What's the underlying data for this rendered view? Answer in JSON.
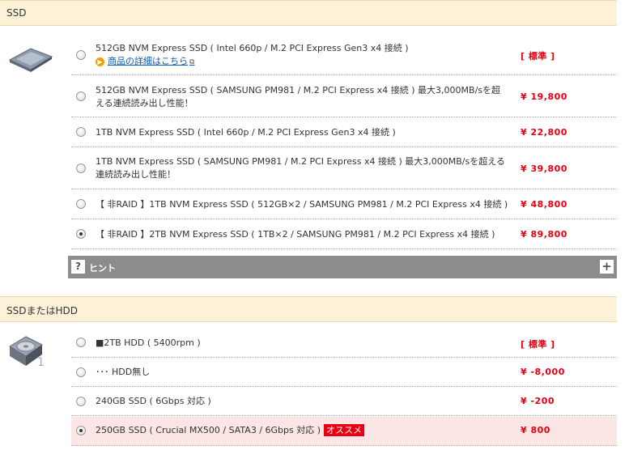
{
  "sections": [
    {
      "title": "SSD",
      "options": [
        {
          "label": "512GB NVM Express SSD ( Intel 660p / M.2 PCI Express Gen3 x4 接続 )",
          "price": "[ 標準 ]",
          "checked": false,
          "detail_link": "商品の詳細はこちら"
        },
        {
          "label": "512GB NVM Express SSD ( SAMSUNG PM981 / M.2 PCI Express x4 接続 ) 最大3,000MB/sを超える連続読み出し性能！",
          "price": "¥ 19,800",
          "checked": false
        },
        {
          "label": "1TB NVM Express SSD ( Intel 660p / M.2 PCI Express Gen3 x4 接続 )",
          "price": "¥ 22,800",
          "checked": false
        },
        {
          "label": "1TB NVM Express SSD ( SAMSUNG PM981 / M.2 PCI Express x4 接続 ) 最大3,000MB/sを超える連続読み出し性能！",
          "price": "¥ 39,800",
          "checked": false
        },
        {
          "label": "【 非RAID 】1TB NVM Express SSD ( 512GB×2 / SAMSUNG PM981 / M.2 PCI Express x4 接続 )",
          "price": "¥ 48,800",
          "checked": false
        },
        {
          "label": "【 非RAID 】2TB NVM Express SSD ( 1TB×2 / SAMSUNG PM981 / M.2 PCI Express x4 接続 )",
          "price": "¥ 89,800",
          "checked": true
        }
      ],
      "hint": {
        "label": "ヒント",
        "expand": "+",
        "q": "?"
      }
    },
    {
      "title": "SSDまたはHDD",
      "icon_caption": "1",
      "options": [
        {
          "label": "■2TB HDD ( 5400rpm )",
          "price": "[ 標準 ]",
          "checked": false
        },
        {
          "label": "･･･ HDD無し",
          "price": "¥ -8,000",
          "checked": false
        },
        {
          "label": "240GB SSD ( 6Gbps 対応 )",
          "price": "¥ -200",
          "checked": false
        },
        {
          "label": "250GB SSD ( Crucial MX500 / SATA3 / 6Gbps 対応 )",
          "price": "¥ 800",
          "checked": true,
          "badge": "オススメ"
        }
      ]
    }
  ],
  "colors": {
    "header_bg": "#fdf2d8",
    "price": "#e60012",
    "hint_bar": "#8c8c8c",
    "highlight_row": "#fbe5e5"
  }
}
